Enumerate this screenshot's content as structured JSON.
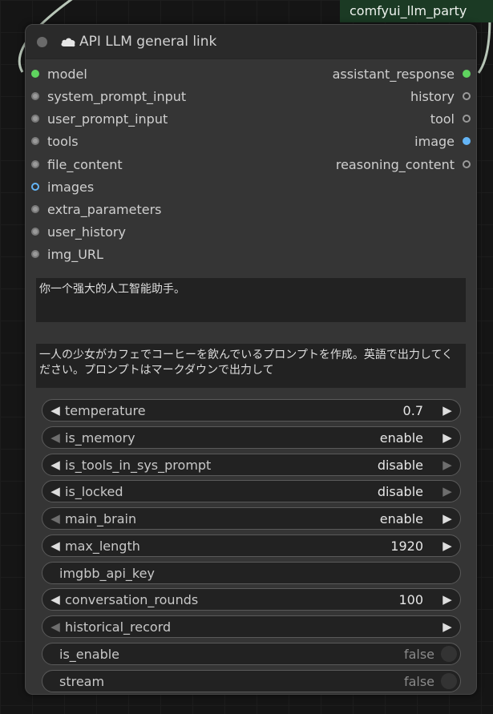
{
  "group": {
    "title": "comfyui_llm_party"
  },
  "node": {
    "title": "API LLM general link",
    "inputs": [
      {
        "label": "model",
        "type": "green"
      },
      {
        "label": "system_prompt_input",
        "type": "gray"
      },
      {
        "label": "user_prompt_input",
        "type": "gray"
      },
      {
        "label": "tools",
        "type": "gray"
      },
      {
        "label": "file_content",
        "type": "gray"
      },
      {
        "label": "images",
        "type": "blue"
      },
      {
        "label": "extra_parameters",
        "type": "gray"
      },
      {
        "label": "user_history",
        "type": "gray"
      },
      {
        "label": "img_URL",
        "type": "gray"
      }
    ],
    "outputs": [
      {
        "label": "assistant_response",
        "type": "green"
      },
      {
        "label": "history",
        "type": "gray"
      },
      {
        "label": "tool",
        "type": "gray"
      },
      {
        "label": "image",
        "type": "blue"
      },
      {
        "label": "reasoning_content",
        "type": "gray"
      }
    ],
    "system_prompt": "你一个强大的人工智能助手。",
    "user_prompt": "一人の少女がカフェでコーヒーを飲んでいるプロンプトを作成。英語で出力してください。プロンプトはマークダウンで出力して",
    "widgets": [
      {
        "label": "temperature",
        "value": "0.7"
      },
      {
        "label": "is_memory",
        "value": "enable"
      },
      {
        "label": "is_tools_in_sys_prompt",
        "value": "disable"
      },
      {
        "label": "is_locked",
        "value": "disable"
      },
      {
        "label": "main_brain",
        "value": "enable"
      },
      {
        "label": "max_length",
        "value": "1920"
      },
      {
        "label": "imgbb_api_key",
        "value": ""
      },
      {
        "label": "conversation_rounds",
        "value": "100"
      },
      {
        "label": "historical_record",
        "value": ""
      },
      {
        "label": "is_enable",
        "value": "false"
      },
      {
        "label": "stream",
        "value": "false"
      }
    ]
  },
  "colors": {
    "model_slot": "#5fd45f",
    "image_slot": "#64b5f6",
    "group_header": "#1b3a24"
  }
}
